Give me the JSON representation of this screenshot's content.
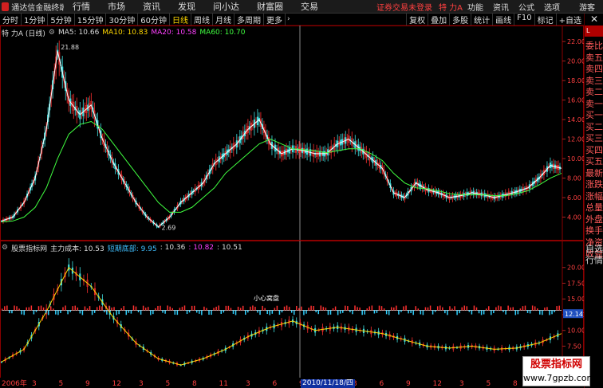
{
  "menubar": {
    "app_title": "通达信金融终端",
    "items": [
      "行情",
      "市场",
      "资讯",
      "发现",
      "问小达",
      "财富圈",
      "交易"
    ],
    "status": "证券交易未登录",
    "stock": "特 力A",
    "right": [
      "功能",
      "资讯",
      "公式",
      "选项"
    ],
    "guest": "游客"
  },
  "toolbar": {
    "periods": [
      "分时",
      "1分钟",
      "5分钟",
      "15分钟",
      "30分钟",
      "60分钟",
      "日线",
      "周线",
      "月线",
      "多周期",
      "更多"
    ],
    "active_period": "日线",
    "right": [
      "复权",
      "叠加",
      "多股",
      "统计",
      "画线",
      "F10",
      "标记",
      "+自选"
    ]
  },
  "side": {
    "close": "✕",
    "tag": "L",
    "items": [
      "委比",
      "卖五",
      "卖四",
      "卖三",
      "卖二",
      "卖一",
      "买一",
      "买二",
      "买三",
      "买四",
      "买五",
      "最新",
      "涨跌",
      "涨幅",
      "总量",
      "外盘",
      "换手",
      "净资",
      "收益"
    ],
    "bottom": [
      "自选",
      "行情"
    ]
  },
  "main_chart": {
    "label": "特 力A (日线)",
    "ma5": "MA5: 10.66",
    "ma10": "MA10: 10.83",
    "ma20": "MA20: 10.58",
    "ma60": "MA60: 10.70",
    "high_label": "21.88",
    "low_label": "2.69"
  },
  "sub_chart": {
    "label": "股票指标网",
    "cost_label": "主力成本: 10.53",
    "band_label": "短期底部: 9.95",
    "v2": ": 10.36",
    "v3": ": 10.82",
    "v4": ": 10.51",
    "current_value": "12.14",
    "annotation": "小心窝盘"
  },
  "x_axis": {
    "start_label": "2006年",
    "selected_date": "2010/11/18/四",
    "months": [
      "3",
      "5",
      "9",
      "12",
      "3",
      "5",
      "8",
      "11",
      "3",
      "6",
      "9",
      "12",
      "3",
      "6",
      "9",
      "12",
      "3",
      "5",
      "8",
      "10"
    ]
  },
  "watermark": {
    "title": "股票指标网",
    "url": "www.7gpzb.com"
  },
  "colors": {
    "up": "#ff3030",
    "down": "#40e0e0",
    "ma5": "#ffffff",
    "ma10": "#ffd700",
    "ma20": "#ff40ff",
    "ma60": "#40ff40"
  },
  "chart_data": [
    {
      "type": "line",
      "title": "",
      "xlabel": "",
      "ylabel": "",
      "ylim": [
        2.0,
        22.5
      ],
      "yticks": [
        4,
        6,
        8,
        10,
        12,
        14,
        16,
        18,
        20,
        22
      ],
      "ytick_labels": [
        "4.00",
        "6.00",
        "8.00",
        "10.00",
        "12.00",
        "14.00",
        "16.00",
        "18.00",
        "20.00",
        "22.00"
      ],
      "x": [
        0,
        5,
        10,
        15,
        20,
        25,
        30,
        35,
        40,
        45,
        50,
        55,
        60,
        65,
        70,
        75,
        80,
        85,
        90,
        95,
        100,
        105,
        110,
        115,
        120,
        125,
        130,
        135,
        140,
        145,
        150,
        155,
        160,
        165,
        170,
        175,
        180,
        185,
        190,
        195,
        200,
        205,
        210,
        215,
        220,
        225,
        230,
        235,
        240,
        245,
        250
      ],
      "series": [
        {
          "name": "MA5",
          "values": [
            3.6,
            4.0,
            5.5,
            8.0,
            13.0,
            21.0,
            16.0,
            14.5,
            15.5,
            12.0,
            9.5,
            7.5,
            5.5,
            4.0,
            3.0,
            4.0,
            5.5,
            6.5,
            7.5,
            9.5,
            10.5,
            11.5,
            13.0,
            14.0,
            11.5,
            10.5,
            11.0,
            10.8,
            10.5,
            10.5,
            11.5,
            12.0,
            11.0,
            10.0,
            9.0,
            6.5,
            6.0,
            7.5,
            6.8,
            6.5,
            6.0,
            6.2,
            6.5,
            6.3,
            6.0,
            6.3,
            6.6,
            7.0,
            8.0,
            9.3,
            9.0
          ]
        },
        {
          "name": "MA60",
          "values": [
            3.5,
            3.6,
            4.0,
            5.0,
            7.0,
            10.0,
            12.5,
            13.5,
            13.8,
            13.0,
            11.5,
            10.0,
            8.5,
            7.0,
            5.5,
            4.5,
            4.5,
            5.0,
            6.0,
            7.0,
            8.5,
            9.5,
            10.5,
            11.5,
            12.0,
            11.5,
            11.0,
            10.9,
            10.8,
            10.6,
            10.8,
            11.0,
            11.0,
            10.5,
            9.8,
            8.5,
            7.5,
            7.0,
            6.9,
            6.7,
            6.4,
            6.3,
            6.3,
            6.3,
            6.2,
            6.2,
            6.4,
            6.7,
            7.3,
            8.0,
            8.5
          ]
        }
      ]
    },
    {
      "type": "line",
      "title": "",
      "ylim": [
        3.0,
        22.5
      ],
      "yticks": [
        7.5,
        10.0,
        12.5,
        15.0,
        17.5,
        20.0
      ],
      "ytick_labels": [
        "7.50",
        "10.00",
        "12.50",
        "15.00",
        "17.50",
        "20.00"
      ],
      "x": [
        0,
        10,
        20,
        30,
        40,
        50,
        60,
        70,
        80,
        90,
        100,
        110,
        120,
        130,
        140,
        150,
        160,
        170,
        180,
        190,
        200,
        210,
        220,
        230,
        240,
        250
      ],
      "series": [
        {
          "name": "主力成本",
          "values": [
            5.0,
            7.0,
            13.0,
            20.0,
            17.0,
            12.0,
            8.0,
            5.5,
            4.5,
            5.5,
            7.0,
            9.0,
            10.5,
            11.5,
            10.0,
            10.5,
            10.0,
            9.5,
            8.5,
            7.5,
            7.2,
            7.5,
            7.0,
            7.2,
            8.0,
            9.5
          ]
        }
      ]
    }
  ]
}
